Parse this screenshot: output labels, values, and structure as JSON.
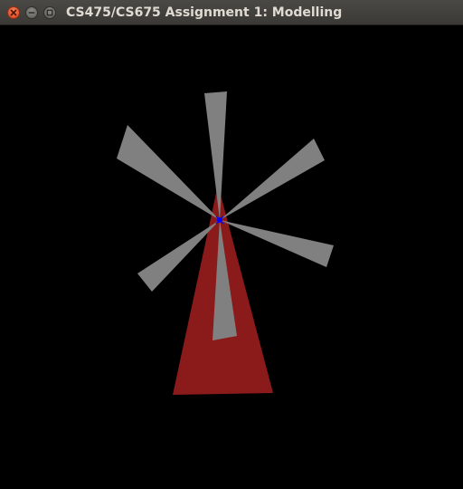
{
  "window": {
    "title": "CS475/CS675 Assignment 1: Modelling",
    "controls": {
      "close_icon": "close-icon",
      "minimize_icon": "minimize-icon",
      "maximize_icon": "maximize-icon"
    }
  },
  "scene": {
    "background_color": "#000000",
    "tower_color": "#8b1a1a",
    "blade_color": "#808080",
    "hub_color": "#0000ff",
    "blade_count": 6
  }
}
